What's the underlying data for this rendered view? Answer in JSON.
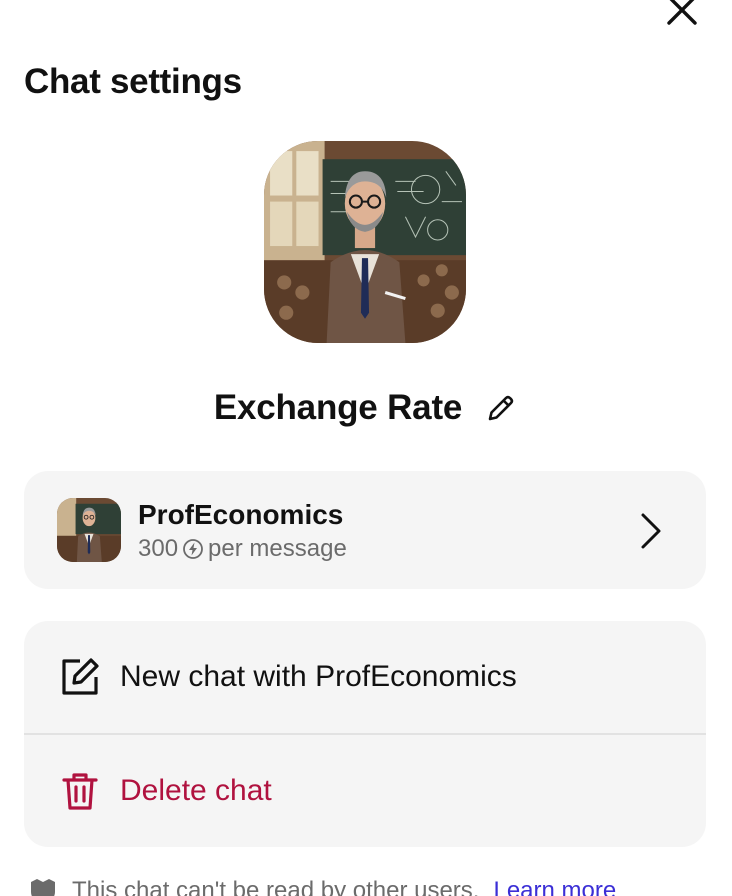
{
  "header": {
    "title": "Chat settings"
  },
  "chat": {
    "name": "Exchange Rate"
  },
  "bot": {
    "name": "ProfEconomics",
    "cost_value": "300",
    "cost_suffix": "per message"
  },
  "actions": {
    "new_chat_label": "New chat with ProfEconomics",
    "delete_label": "Delete chat"
  },
  "footer": {
    "privacy_text": "This chat can't be read by other users.",
    "learn_more": "Learn more"
  },
  "colors": {
    "card_background": "#f5f5f5",
    "danger": "#b0123f",
    "link": "#3b2fd6",
    "muted_text": "#6b6b6b"
  },
  "icons": {
    "close": "close-icon",
    "edit": "pencil-icon",
    "compute": "bolt-circle-icon",
    "chevron": "chevron-right-icon",
    "new_chat": "compose-icon",
    "delete": "trash-icon",
    "privacy": "shield-icon"
  }
}
